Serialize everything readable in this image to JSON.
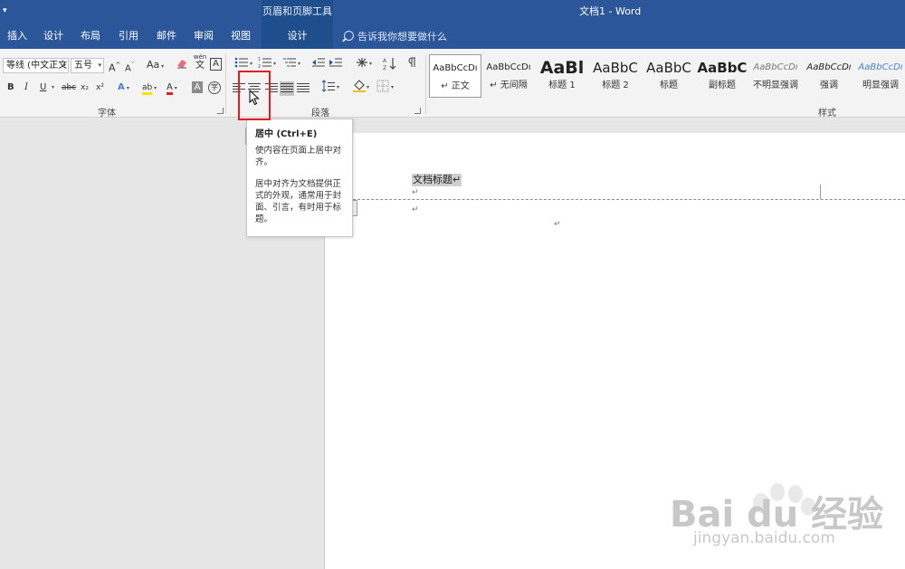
{
  "titlebar": {
    "context_tool": "页眉和页脚工具",
    "document_title": "文档1  -  Word"
  },
  "tabs": [
    {
      "label": "插入"
    },
    {
      "label": "设计"
    },
    {
      "label": "布局"
    },
    {
      "label": "引用"
    },
    {
      "label": "邮件"
    },
    {
      "label": "审阅"
    },
    {
      "label": "视图"
    },
    {
      "label": "设计"
    }
  ],
  "tell_me": "告诉我你想要做什么",
  "font_group": {
    "font_name": "等线 (中文正文",
    "font_size": "五号",
    "label": "字体",
    "grow": "A",
    "shrink": "A",
    "change_case": "Aa",
    "wen": "wén",
    "wen_char": "文",
    "border_char": "A",
    "bold": "B",
    "italic": "I",
    "underline": "U",
    "strike": "abc",
    "subscript": "x₂",
    "superscript": "x²",
    "effects": "A",
    "highlight": "ab",
    "font_color": "A",
    "shade": "A",
    "enclose": "字"
  },
  "paragraph_group": {
    "label": "段落"
  },
  "styles_group": {
    "label": "样式",
    "items": [
      {
        "sample": "AaBbCcDı",
        "name": "↵ 正文"
      },
      {
        "sample": "AaBbCcDı",
        "name": "↵ 无间隔"
      },
      {
        "sample": "AaBl",
        "name": "标题 1"
      },
      {
        "sample": "AaBbC",
        "name": "标题 2"
      },
      {
        "sample": "AaBbC",
        "name": "标题"
      },
      {
        "sample": "AaBbC",
        "name": "副标题"
      },
      {
        "sample": "AaBbCcDı",
        "name": "不明显强调"
      },
      {
        "sample": "AaBbCcDı",
        "name": "强调"
      },
      {
        "sample": "AaBbCcDı",
        "name": "明显强调"
      }
    ]
  },
  "tooltip": {
    "title": "居中 (Ctrl+E)",
    "line1": "使内容在页面上居中对齐。",
    "line2": "居中对齐为文档提供正式的外观，通常用于封面、引言，有时用于标题。"
  },
  "document": {
    "heading": "文档标题↵",
    "para_mark": "↵"
  },
  "watermark": {
    "text": "Bai du 经验",
    "url": "jingyan.baidu.com"
  },
  "colors": {
    "title_blue": "#2b579a",
    "context_blue": "#1f4e8c",
    "highlight_red": "#e02020"
  }
}
